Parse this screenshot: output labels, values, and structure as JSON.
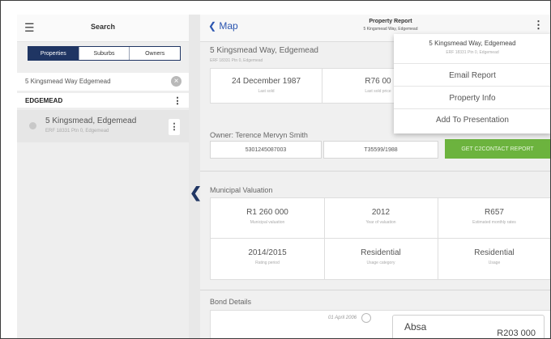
{
  "sidebar": {
    "title": "Search",
    "tabs": [
      {
        "label": "Properties",
        "active": true
      },
      {
        "label": "Suburbs",
        "active": false
      },
      {
        "label": "Owners",
        "active": false
      }
    ],
    "search_value": "5 Kingsmead Way Edgemead",
    "area_heading": "EDGEMEAD",
    "result": {
      "title": "5 Kingsmead, Edgemead",
      "subtitle": "ERF 18331 Ptn 0, Edgemead"
    }
  },
  "header": {
    "back_label": "Map",
    "title": "Property Report",
    "subtitle": "5 Kingsmead Way, Edgemead"
  },
  "property": {
    "address": "5 Kingsmead Way, Edgemead",
    "erf": "ERF 18331 Ptn 0, Edgemead",
    "sale": [
      {
        "value": "24 December 1987",
        "label": "Last sold"
      },
      {
        "value": "R76 00",
        "label": "Last sold price"
      }
    ],
    "owner_label": "Owner: Terence Mervyn Smith",
    "id_number": "5301245087003",
    "deed_number": "T35599/1988",
    "contact_button": "GET C2CONTACT REPORT"
  },
  "municipal": {
    "heading": "Municipal Valuation",
    "row1": [
      {
        "value": "R1 260 000",
        "label": "Municipal valuation"
      },
      {
        "value": "2012",
        "label": "Year of valuation"
      },
      {
        "value": "R657",
        "label": "Estimated monthly rates"
      }
    ],
    "row2": [
      {
        "value": "2014/2015",
        "label": "Rating period"
      },
      {
        "value": "Residential",
        "label": "Usage category"
      },
      {
        "value": "Residential",
        "label": "Usage"
      }
    ]
  },
  "bond": {
    "heading": "Bond Details",
    "date": "01 April 2006",
    "bank": "Absa",
    "amount": "R203 000"
  },
  "menu": {
    "header_title": "5 Kingsmead Way, Edgemead",
    "header_subtitle": "ERF 18331 Ptn 0, Edgemead",
    "items": [
      "Email Report",
      "Property Info",
      "Add To Presentation"
    ]
  },
  "colors": {
    "accent_navy": "#1f3563",
    "link_blue": "#2b55b0",
    "action_green": "#6cb33e"
  }
}
